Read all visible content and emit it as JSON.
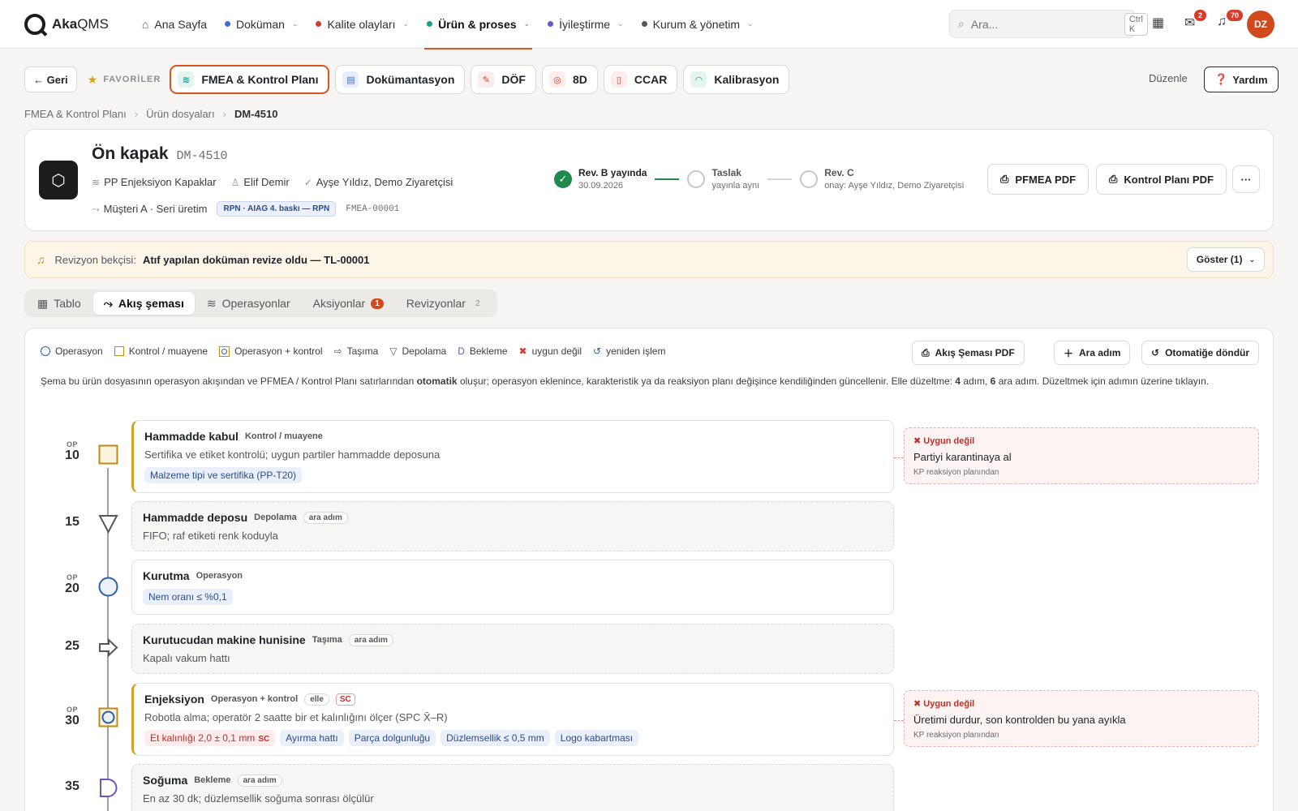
{
  "nav": {
    "logo_bold": "Aka",
    "logo_rest": "QMS",
    "items": [
      {
        "label": "Ana Sayfa",
        "color": "",
        "active": false
      },
      {
        "label": "Doküman",
        "color": "#3b6fd4",
        "active": false
      },
      {
        "label": "Kalite olayları",
        "color": "#d83a2b",
        "active": false
      },
      {
        "label": "Ürün & proses",
        "color": "#1f9a8a",
        "active": true
      },
      {
        "label": "İyileştirme",
        "color": "#6b55c9",
        "active": false
      },
      {
        "label": "Kurum & yönetim",
        "color": "#54575c",
        "active": false
      }
    ],
    "search_placeholder": "Ara...",
    "search_shortcut": "Ctrl K",
    "inbox_badge": "2",
    "notif_badge": "70",
    "avatar": "DZ"
  },
  "favbar": {
    "back": "← Geri",
    "label": "FAVORİLER",
    "chips": [
      {
        "label": "FMEA & Kontrol Planı",
        "active": true
      },
      {
        "label": "Dokümantasyon",
        "active": false
      },
      {
        "label": "DÖF",
        "active": false
      },
      {
        "label": "8D",
        "active": false
      },
      {
        "label": "CCAR",
        "active": false
      },
      {
        "label": "Kalibrasyon",
        "active": false
      }
    ],
    "edit": "Düzenle",
    "help": "Yardım"
  },
  "breadcrumb": [
    "FMEA & Kontrol Planı",
    "Ürün dosyaları",
    "DM-4510"
  ],
  "doc": {
    "title": "Ön kapak",
    "code": "DM-4510",
    "product": "PP Enjeksiyon Kapaklar",
    "owner": "Elif Demir",
    "approvers": "Ayşe Yıldız, Demo Ziyaretçisi",
    "customer": "Müşteri A · Seri üretim",
    "rpn_chip": "RPN · AIAG 4. baskı — RPN",
    "fmea_code": "FMEA-00001",
    "revs": [
      {
        "title": "Rev. B yayında",
        "sub": "30.09.2026",
        "done": true
      },
      {
        "title": "Taslak",
        "sub": "yayınla aynı",
        "done": false
      },
      {
        "title": "Rev. C",
        "sub": "onay: Ayşe Yıldız, Demo Ziyaretçisi",
        "done": false
      }
    ],
    "pfmea_pdf": "PFMEA PDF",
    "kp_pdf": "Kontrol Planı PDF",
    "more": "···"
  },
  "watcher": {
    "label": "Revizyon bekçisi:",
    "message": "Atıf yapılan doküman revize oldu — TL-00001",
    "button": "Göster (1)"
  },
  "tabs": [
    {
      "label": "Tablo",
      "icon": "▦",
      "count": "",
      "active": false
    },
    {
      "label": "Akış şeması",
      "icon": "⤳",
      "count": "",
      "active": true
    },
    {
      "label": "Operasyonlar",
      "icon": "≋",
      "count": "",
      "active": false
    },
    {
      "label": "Aksiyonlar",
      "icon": "",
      "count": "1",
      "active": false
    },
    {
      "label": "Revizyonlar",
      "icon": "",
      "count": "2",
      "active": false
    }
  ],
  "flow": {
    "legend": [
      "Operasyon",
      "Kontrol / muayene",
      "Operasyon + kontrol",
      "Taşıma",
      "Depolama",
      "Bekleme",
      "uygun değil",
      "yeniden işlem"
    ],
    "btn_pdf": "Akış Şeması PDF",
    "btn_add": "Ara adım",
    "btn_auto": "Otomatiğe döndür",
    "desc_a": "Şema bu ürün dosyasının operasyon akışından ve PFMEA / Kontrol Planı satırlarından ",
    "desc_bold": "otomatik",
    "desc_b": " oluşur; operasyon eklenince, karakteristik ya da reaksiyon planı değişince kendiliğinden güncellenir. Elle düzeltme: ",
    "desc_n1": "4",
    "desc_c": " adım, ",
    "desc_n2": "6",
    "desc_d": " ara adım. Düzeltmek için adımın üzerine tıklayın.",
    "steps": [
      {
        "op": "OP",
        "num": "10",
        "title": "Hammadde kabul",
        "type": "Kontrol / muayene",
        "desc": "Sertifika ve etiket kontrolü; uygun partiler hammadde deposuna",
        "chips": [
          "Malzeme tipi ve sertifika (PP-T20)"
        ]
      },
      {
        "op": "",
        "num": "15",
        "title": "Hammadde deposu",
        "type": "Depolama",
        "tag": "ara adım",
        "desc": "FIFO; raf etiketi renk koduyla"
      },
      {
        "op": "OP",
        "num": "20",
        "title": "Kurutma",
        "type": "Operasyon",
        "chips": [
          "Nem oranı ≤ %0,1"
        ]
      },
      {
        "op": "",
        "num": "25",
        "title": "Kurutucudan makine hunisine",
        "type": "Taşıma",
        "tag": "ara adım",
        "desc": "Kapalı vakum hattı"
      },
      {
        "op": "OP",
        "num": "30",
        "title": "Enjeksiyon",
        "type": "Operasyon + kontrol",
        "tag": "elle",
        "sc": "SC",
        "desc": "Robotla alma; operatör 2 saatte bir et kalınlığını ölçer (SPC X̄–R)",
        "chip_red": "Et kalınlığı 2,0 ± 0,1 mm",
        "chip_red_sc": "SC",
        "chips": [
          "Ayırma hattı",
          "Parça dolgunluğu",
          "Düzlemsellik ≤ 0,5 mm",
          "Logo kabartması"
        ]
      },
      {
        "op": "",
        "num": "35",
        "title": "Soğuma",
        "type": "Bekleme",
        "tag": "ara adım",
        "desc": "En az 30 dk; düzlemsellik soğuma sonrası ölçülür"
      }
    ],
    "reactions": [
      {
        "head": "✖ Uygun değil",
        "body": "Partiyi karantinaya al",
        "foot": "KP reaksiyon planından"
      },
      {
        "head": "✖ Uygun değil",
        "body": "Üretimi durdur, son kontrolden bu yana ayıkla",
        "foot": "KP reaksiyon planından"
      }
    ]
  }
}
